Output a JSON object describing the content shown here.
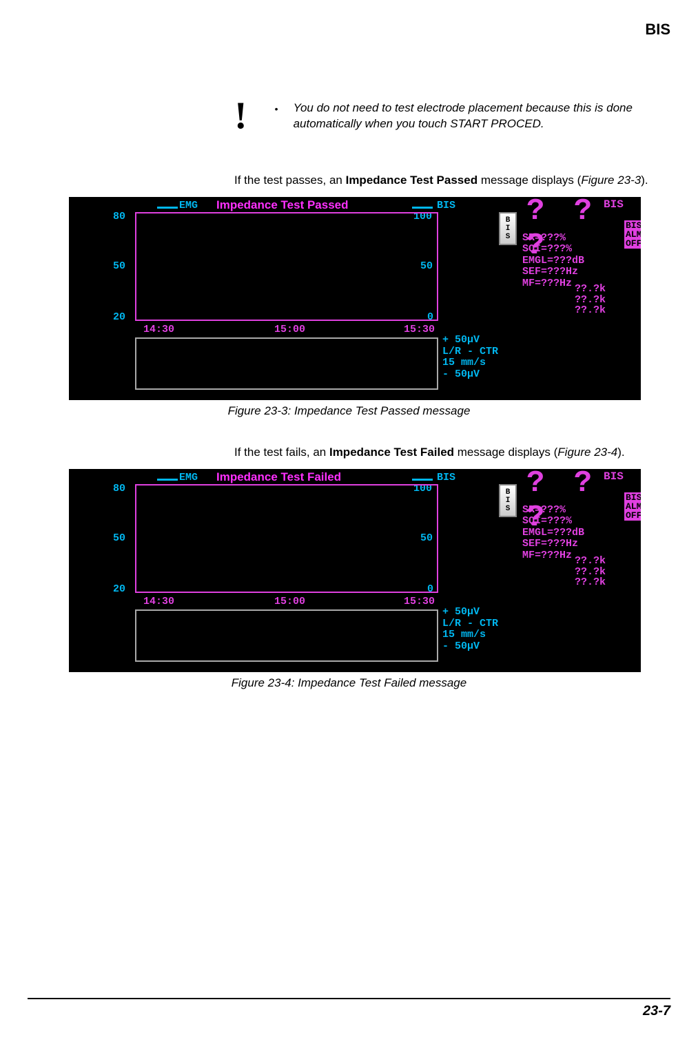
{
  "header": {
    "title": "BIS"
  },
  "note": {
    "bang": "!",
    "bullet": "•",
    "text": "You do not need to test electrode placement because this is done automatically when you touch START PROCED."
  },
  "pass_intro": {
    "pre": "If the test passes, an ",
    "bold": "Impedance Test Passed",
    "mid": " message displays (",
    "ref": "Figure 23-3",
    "post": ")."
  },
  "fail_intro": {
    "pre": "If the test fails, an ",
    "bold": "Impedance Test Failed",
    "mid": " message displays (",
    "ref": "Figure 23-4",
    "post": ")."
  },
  "caption1": "Figure 23-3: Impedance Test Passed message",
  "caption2": "Figure 23-4: Impedance Test Failed message",
  "footer": "23-7",
  "screenshot": {
    "emg_label": "EMG",
    "bis_label": "BIS",
    "msg_passed": "Impedance Test Passed",
    "msg_failed": "Impedance Test Failed",
    "emg_scale": {
      "hi": "80",
      "mid": "50",
      "lo": "20"
    },
    "bis_scale": {
      "hi": "100",
      "mid": "50",
      "lo": "0"
    },
    "times": {
      "t1": "14:30",
      "t2": "15:00",
      "t3": "15:30"
    },
    "qqq": "? ? ?",
    "bis_title": "BIS",
    "bis_button": "B\nI\nS",
    "params": [
      "SR=???%",
      "SQI=???%",
      "EMGL=???dB",
      "SEF=???Hz",
      "MF=???Hz"
    ],
    "impedances": [
      "??.?k",
      "??.?k",
      "??.?k"
    ],
    "wave_info": [
      "+ 50μV",
      "L/R - CTR",
      "15 mm/s",
      "- 50μV"
    ],
    "alm": "BIS\nALM\nOFF"
  }
}
